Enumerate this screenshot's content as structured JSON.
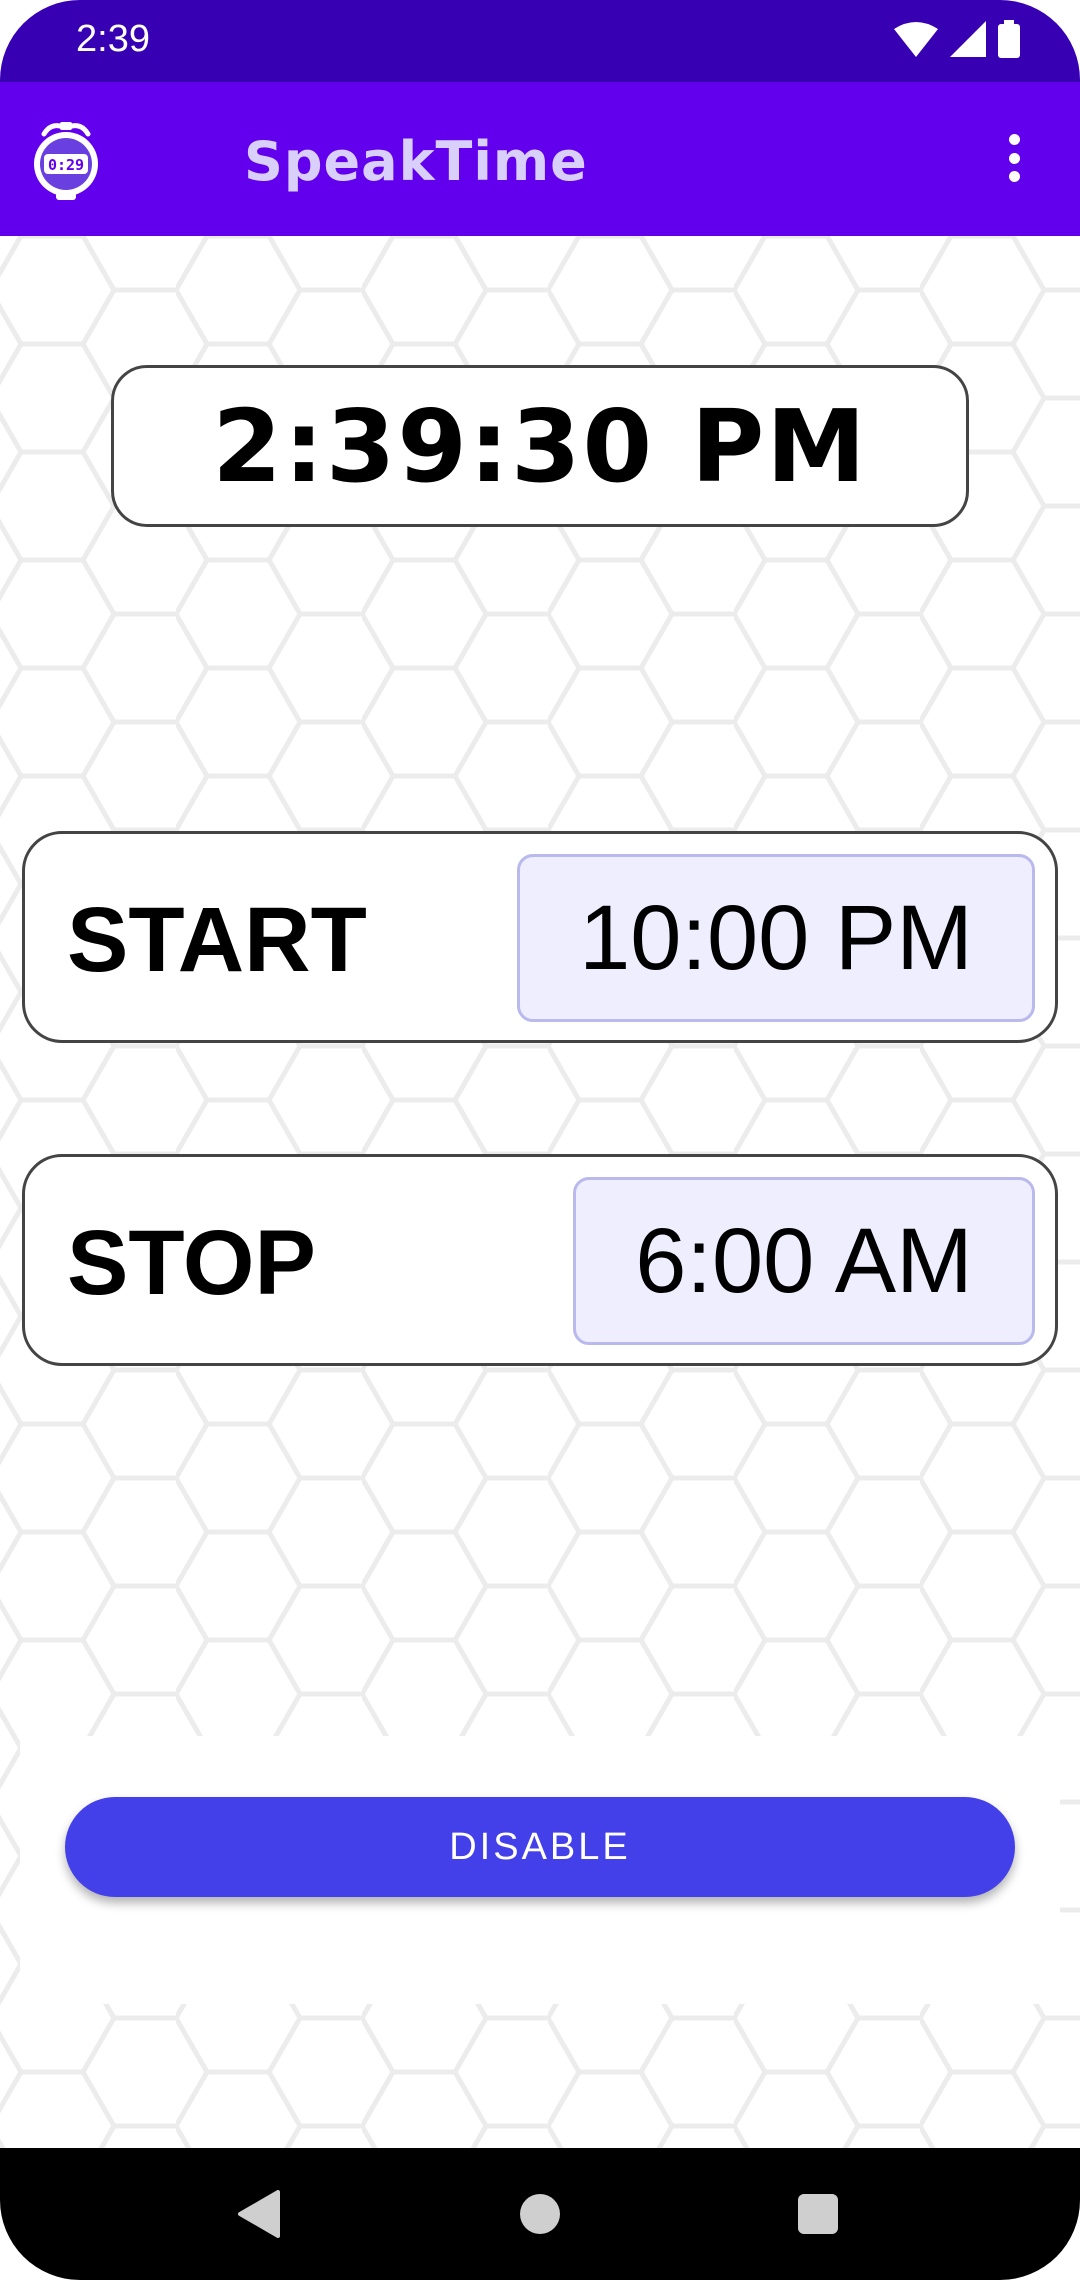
{
  "status_bar": {
    "time": "2:39",
    "icons": [
      "wifi-icon",
      "cell-signal-icon",
      "battery-icon"
    ]
  },
  "app_bar": {
    "title": "SpeakTime",
    "app_icon": "stopwatch-icon",
    "app_icon_text": "0:29",
    "menu_icon": "overflow-menu-icon"
  },
  "clock": {
    "current_time": "2:39:30 PM"
  },
  "schedule": {
    "start_label": "START",
    "start_time": "10:00 PM",
    "stop_label": "STOP",
    "stop_time": "6:00 AM"
  },
  "actions": {
    "disable_label": "DISABLE"
  },
  "nav": {
    "icons": [
      "back-icon",
      "home-icon",
      "recents-icon"
    ]
  },
  "colors": {
    "status_bar": "#3700b3",
    "app_bar": "#6200ee",
    "title": "#d9cffb",
    "button": "#4340ea",
    "chip_fill": "#eeeefe",
    "chip_border": "#b9b9ee"
  }
}
